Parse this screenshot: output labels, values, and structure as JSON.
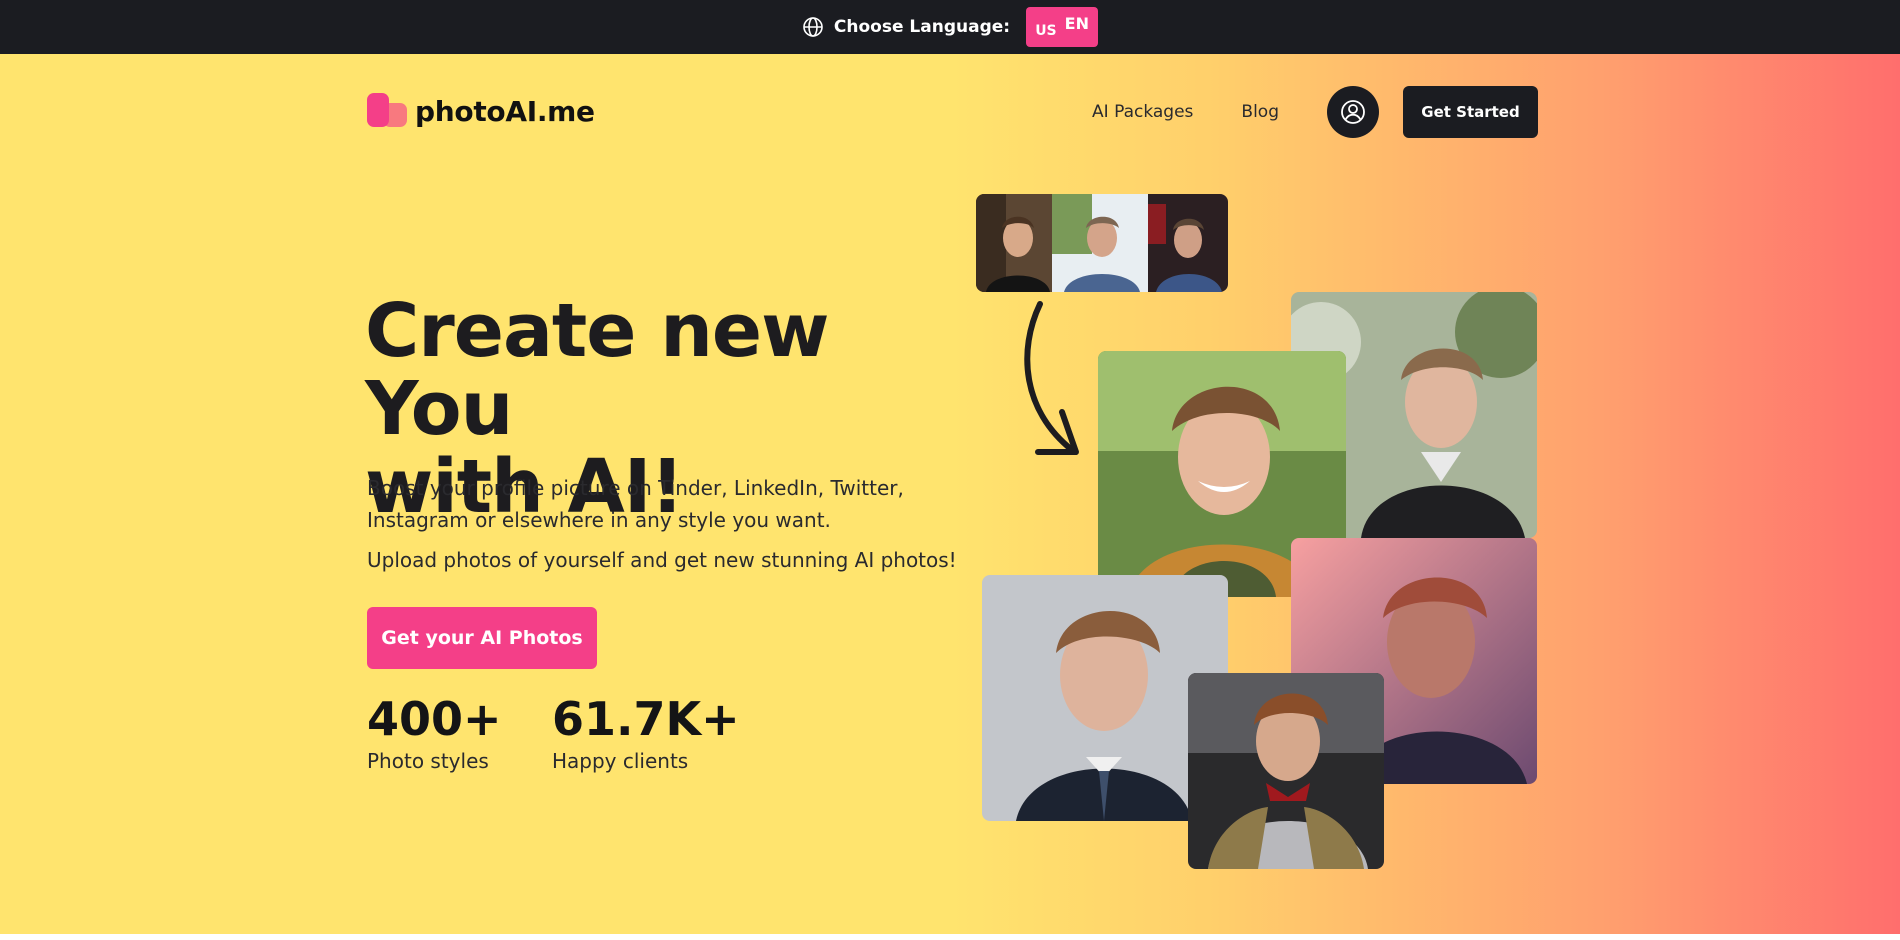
{
  "topbar": {
    "label": "Choose Language:",
    "globe_icon": "globe-icon",
    "lang_flag": "US",
    "lang_code": "EN"
  },
  "header": {
    "logo_text": "photoAI.me",
    "nav": [
      "AI Packages",
      "Blog"
    ],
    "user_icon": "user-circle-icon",
    "cta": "Get Started"
  },
  "hero": {
    "headline_line1": "Create new You",
    "headline_line2": "with AI!",
    "subtitle1": "Boost your profile picture on Tinder, LinkedIn, Twitter, Instagram or elsewhere in any style you want.",
    "subtitle2": "Upload photos of yourself and get new stunning AI photos!",
    "cta": "Get your AI Photos",
    "stats": [
      {
        "value": "400+",
        "label": "Photo styles"
      },
      {
        "value": "61.7K+",
        "label": "Happy clients"
      }
    ]
  },
  "colors": {
    "accent": "#f43f88",
    "dark": "#1b1c21",
    "yellow": "#ffe46e",
    "coral": "#ff6e6d"
  },
  "gallery": {
    "inputs": [
      "selfie-dark-shirt",
      "selfie-outdoor-blue-shirt",
      "selfie-car-blue-shirt"
    ],
    "outputs": [
      "portrait-smiling-fur-collar",
      "portrait-leather-jacket",
      "portrait-sunset",
      "portrait-suit-tie",
      "portrait-knight-armor"
    ]
  }
}
